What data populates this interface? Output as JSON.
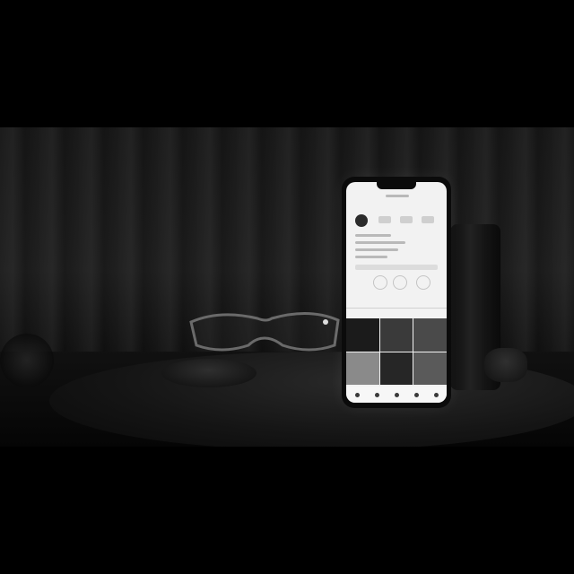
{
  "scene": {
    "description_free": true,
    "colors": {
      "background": "#000000",
      "screen": "#f2f2f2",
      "phone_body": "#0b0b0b"
    },
    "icons": [
      "glasses-icon",
      "camera-lens-icon",
      "phone-icon"
    ]
  }
}
